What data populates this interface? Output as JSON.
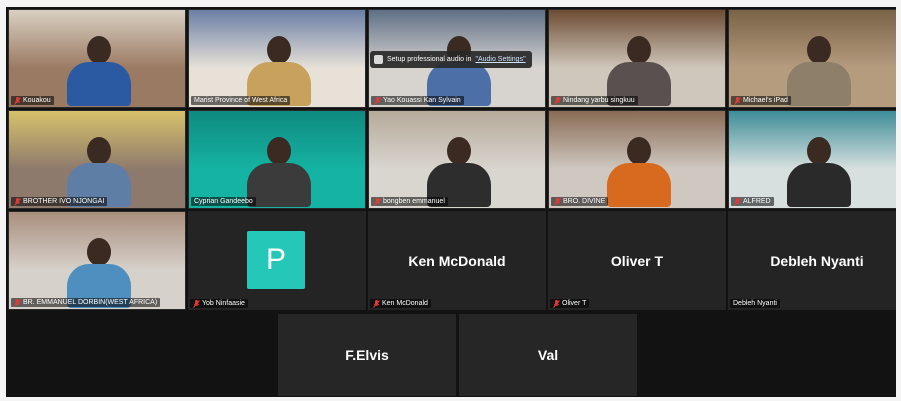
{
  "meeting": {
    "participants": [
      {
        "name": "Kouakou",
        "muted": true,
        "video": true,
        "scene": {
          "bg": "#9b7a63",
          "accent": "#d9cfc2",
          "shirt": "#2b5aa3"
        }
      },
      {
        "name": "Marist Province of West Africa",
        "muted": false,
        "video": true,
        "scene": {
          "bg": "#e7e1d8",
          "accent": "#6b7fa5",
          "shirt": "#c8a25c"
        }
      },
      {
        "name": "Yao Kouassi Kan Sylvain",
        "muted": true,
        "video": true,
        "scene": {
          "bg": "#d7d4d0",
          "accent": "#5f6f86",
          "shirt": "#4d6fa8"
        }
      },
      {
        "name": "Nindang yarbu singkuu",
        "muted": true,
        "video": true,
        "scene": {
          "bg": "#cfc7bb",
          "accent": "#6e4c34",
          "shirt": "#5a5050"
        }
      },
      {
        "name": "Michael's iPad",
        "muted": true,
        "video": true,
        "scene": {
          "bg": "#b69c7f",
          "accent": "#7a6247",
          "shirt": "#8d7f6a"
        }
      },
      {
        "name": "BROTHER IVO NJONGAI",
        "muted": true,
        "video": true,
        "scene": {
          "bg": "#8e7a6d",
          "accent": "#d7c16b",
          "shirt": "#5f7ea6"
        }
      },
      {
        "name": "Cyprian Gandeebo",
        "muted": false,
        "video": true,
        "scene": {
          "bg": "#15b3a3",
          "accent": "#0f8a80",
          "shirt": "#3b3b3b"
        }
      },
      {
        "name": "bongben emmanuel",
        "muted": true,
        "video": true,
        "scene": {
          "bg": "#d9d5cf",
          "accent": "#b6aa9a",
          "shirt": "#2d2d2d"
        }
      },
      {
        "name": "BRO. DIVINE",
        "muted": true,
        "video": true,
        "scene": {
          "bg": "#cfc8c0",
          "accent": "#8a6b55",
          "shirt": "#d76a1e"
        }
      },
      {
        "name": "ALFRED",
        "muted": true,
        "video": true,
        "scene": {
          "bg": "#d8e0df",
          "accent": "#3d8d98",
          "shirt": "#2a2a2a"
        }
      },
      {
        "name": "BR. EMMANUEL DORBIN(WEST AFRICA)",
        "muted": true,
        "video": true,
        "scene": {
          "bg": "#d7d1cb",
          "accent": "#a98f7d",
          "shirt": "#4f8fbf"
        }
      },
      {
        "name": "Yob Ninfaasie",
        "muted": true,
        "video": false,
        "initial": "P",
        "label": ""
      },
      {
        "name": "Ken McDonald",
        "muted": true,
        "video": false,
        "label": "Ken McDonald"
      },
      {
        "name": "Oliver T",
        "muted": true,
        "video": false,
        "label": "Oliver T"
      },
      {
        "name": "Debleh Nyanti",
        "muted": false,
        "video": false,
        "label": "Debleh Nyanti"
      }
    ],
    "bottom": [
      {
        "label": "F.Elvis"
      },
      {
        "label": "Val"
      }
    ],
    "toast": {
      "text": "Setup professional audio in",
      "link": "\"Audio Settings\""
    },
    "colors": {
      "muted_icon": "#e53935",
      "avatar_bg": "#25c7b8"
    }
  }
}
